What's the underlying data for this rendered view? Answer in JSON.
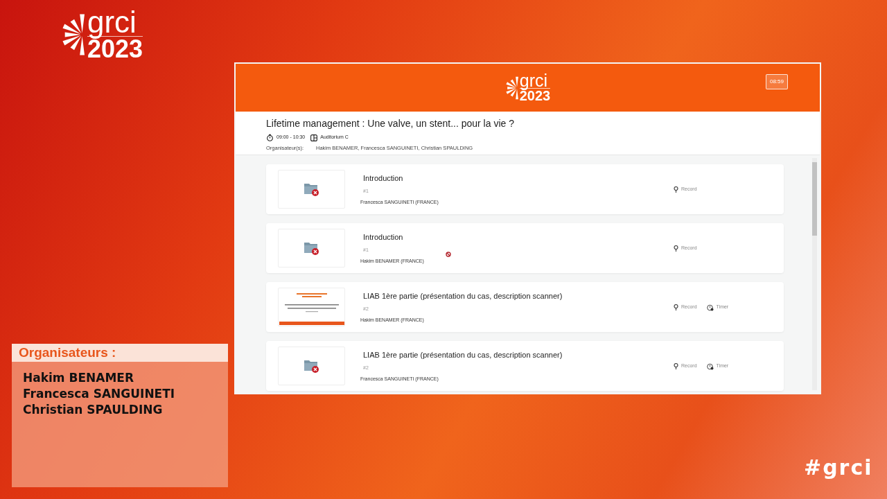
{
  "event_logo": {
    "name": "grci",
    "year": "2023"
  },
  "organisers_panel": {
    "heading": "Organisateurs :",
    "names": [
      "Hakim BENAMER",
      "Francesca SANGUINETI",
      "Christian SPAULDING"
    ]
  },
  "hashtag": "#grci",
  "app": {
    "logo": {
      "name": "grci",
      "year": "2023"
    },
    "clock": "08:59",
    "session": {
      "title": "Lifetime management :  Une valve, un stent... pour la vie ?",
      "time": "09:00 - 10:30",
      "room": "Auditorium C",
      "organisers_label": "Organisateur(s):",
      "organisers": "Hakim BENAMER, Francesca SANGUINETI, Christian SPAULDING"
    },
    "talks": [
      {
        "title": "Introduction",
        "number": "#1",
        "speaker": "Francesca SANGUINETI  (FRANCE)",
        "thumbnail": {
          "kind": "missing"
        },
        "blocked": false,
        "actions": [
          {
            "kind": "record",
            "label": "Record"
          }
        ]
      },
      {
        "title": "Introduction",
        "number": "#1",
        "speaker": "Hakim BENAMER  (FRANCE)",
        "thumbnail": {
          "kind": "missing"
        },
        "blocked": true,
        "actions": [
          {
            "kind": "record",
            "label": "Record"
          }
        ]
      },
      {
        "title": "LIAB 1ère partie (présentation du cas, description scanner)",
        "number": "#2",
        "speaker": "Hakim BENAMER  (FRANCE)",
        "thumbnail": {
          "kind": "slide"
        },
        "blocked": false,
        "actions": [
          {
            "kind": "record",
            "label": "Record"
          },
          {
            "kind": "timer",
            "label": "Timer"
          }
        ]
      },
      {
        "title": "LIAB 1ère partie (présentation du cas, description scanner)",
        "number": "#2",
        "speaker": "Francesca SANGUINETI  (FRANCE)",
        "thumbnail": {
          "kind": "missing"
        },
        "blocked": false,
        "actions": [
          {
            "kind": "record",
            "label": "Record"
          },
          {
            "kind": "timer",
            "label": "Timer"
          }
        ]
      }
    ]
  }
}
